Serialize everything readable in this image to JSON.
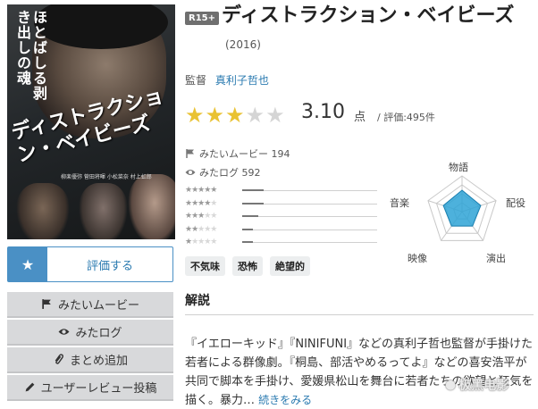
{
  "poster": {
    "tagline": "ほとばしる剥き出しの魂",
    "title_art": "ディストラクション・ベイビーズ",
    "cast_small": "柳楽優弥 菅田将暉 小松菜奈 村上虹郎"
  },
  "header": {
    "rating_badge": "R15+",
    "title": "ディストラクション・ベイビーズ",
    "year": "(2016)"
  },
  "director": {
    "label": "監督",
    "name": "真利子哲也"
  },
  "score": {
    "stars_filled": 3,
    "stars_total": 5,
    "value": "3.10",
    "unit": "点",
    "count": "/ 評価:495件",
    "star_color": "#e9c233"
  },
  "stats": {
    "want_to_see": "みたいムービー 194",
    "watched_log": "みたログ 592"
  },
  "distribution": [
    {
      "stars": 5,
      "fraction": 0.16
    },
    {
      "stars": 4,
      "fraction": 0.16
    },
    {
      "stars": 3,
      "fraction": 0.12
    },
    {
      "stars": 2,
      "fraction": 0.08
    },
    {
      "stars": 1,
      "fraction": 0.08
    }
  ],
  "tags": [
    "不気味",
    "恐怖",
    "絶望的"
  ],
  "radar": {
    "labels": [
      "物語",
      "配役",
      "演出",
      "映像",
      "音楽"
    ],
    "values": [
      0.6,
      0.55,
      0.5,
      0.5,
      0.55
    ],
    "fill_color": "#2ea3d6"
  },
  "actions": {
    "rate": "評価する",
    "want": "みたいムービー",
    "watched": "みたログ",
    "add_to_list": "まとめ追加",
    "review": "ユーザーレビュー投稿"
  },
  "explanation": {
    "title": "解説",
    "text": "『イエローキッド』『NINIFUNI』などの真利子哲也監督が手掛けた若者による群像劇。『桐島、部活やめるってよ』などの喜安浩平が共同で脚本を手掛け、愛媛県松山を舞台に若者たちの欲望と狂気を描く。暴力…",
    "more": "続きをみる"
  },
  "watermark": "极黑电影"
}
